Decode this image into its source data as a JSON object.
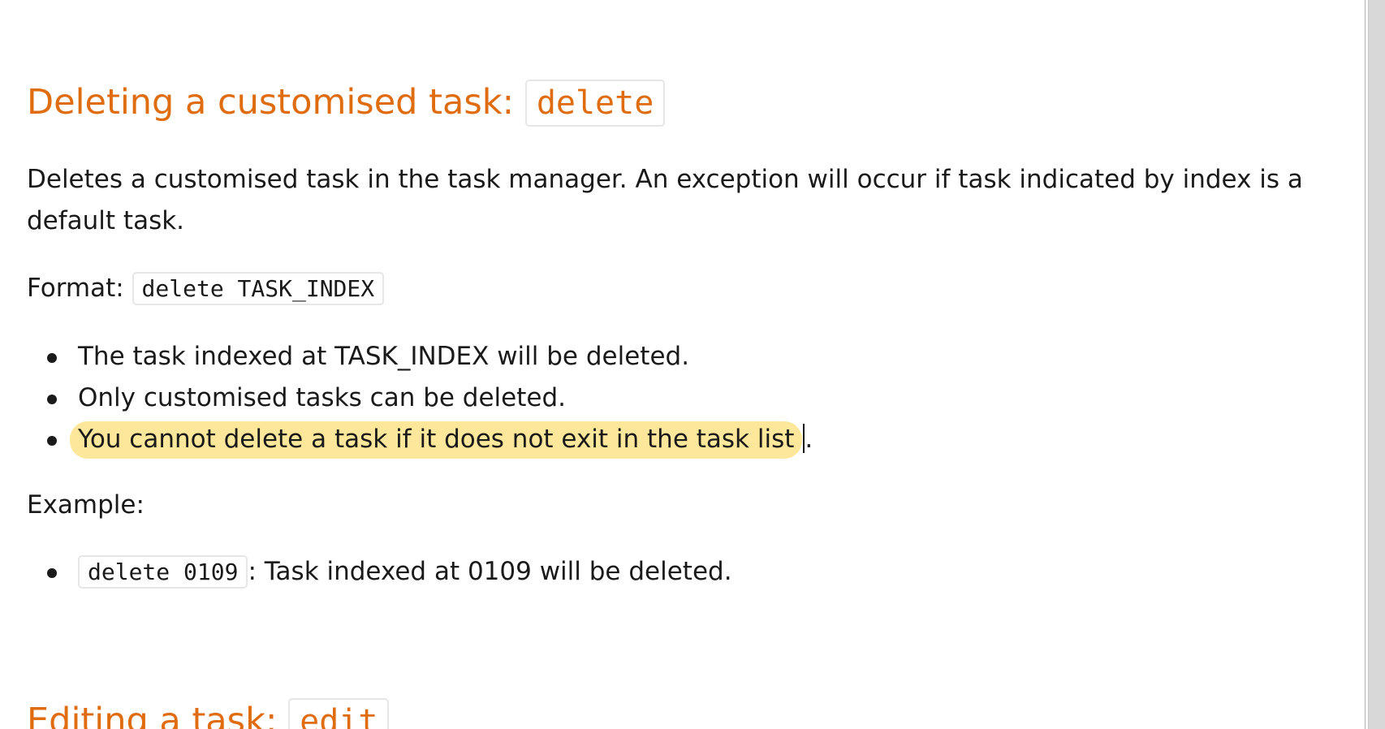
{
  "section_delete": {
    "heading_text": "Deleting a customised task:",
    "heading_code": "delete",
    "description": "Deletes a customised task in the task manager. An exception will occur if task indicated by index is a default task.",
    "format_label": "Format:",
    "format_code": "delete TASK_INDEX",
    "notes": [
      "The task indexed at TASK_INDEX will be deleted.",
      "Only customised tasks can be deleted.",
      "You cannot delete a task if it does not exit in the task list."
    ],
    "highlighted_note_text": "You cannot delete a task if it does not exit in the task list",
    "highlighted_note_tail": ".",
    "example_label": "Example:",
    "examples": [
      {
        "code": "delete 0109",
        "text": ": Task indexed at 0109 will be deleted."
      }
    ]
  },
  "section_edit": {
    "heading_text": "Editing a task:",
    "heading_code": "edit"
  },
  "colors": {
    "heading": "#e06c10",
    "highlight": "#fde79a",
    "text": "#1a1a1a"
  }
}
